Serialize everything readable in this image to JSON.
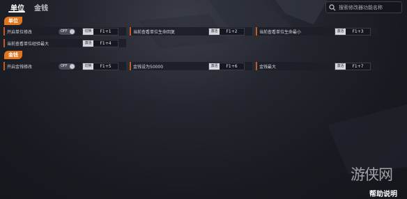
{
  "tabs": [
    {
      "label": "单位",
      "active": true
    },
    {
      "label": "金钱",
      "active": false
    }
  ],
  "search": {
    "placeholder": "搜索修改器功能名称",
    "icon": "search-icon"
  },
  "sections": [
    {
      "title": "单位",
      "rows": [
        [
          {
            "label": "开启单位修改",
            "toggle": "OFF",
            "mode": "切换",
            "key": "F1+1"
          },
          {
            "label": "当前查看单位生命回复",
            "mode": "激活",
            "key": "F1+2"
          },
          {
            "label": "当前查看单位生命最小",
            "mode": "激活",
            "key": "F1+3"
          }
        ],
        [
          {
            "label": "当前查看单位经验最大",
            "mode": "激活",
            "key": "F1+4"
          }
        ]
      ]
    },
    {
      "title": "金钱",
      "rows": [
        [
          {
            "label": "开启金钱修改",
            "toggle": "OFF",
            "mode": "切换",
            "key": "F1+5"
          },
          {
            "label": "金钱设为50000",
            "mode": "激活",
            "key": "F1+6"
          },
          {
            "label": "金钱最大",
            "mode": "激活",
            "key": "F1+7"
          }
        ]
      ]
    }
  ],
  "footer": {
    "logo_text": "游侠网",
    "help_label": "帮助说明"
  },
  "colors": {
    "accent": "#e2761e",
    "cell_bg": "#1c1e28",
    "background": "#1c1e25"
  }
}
